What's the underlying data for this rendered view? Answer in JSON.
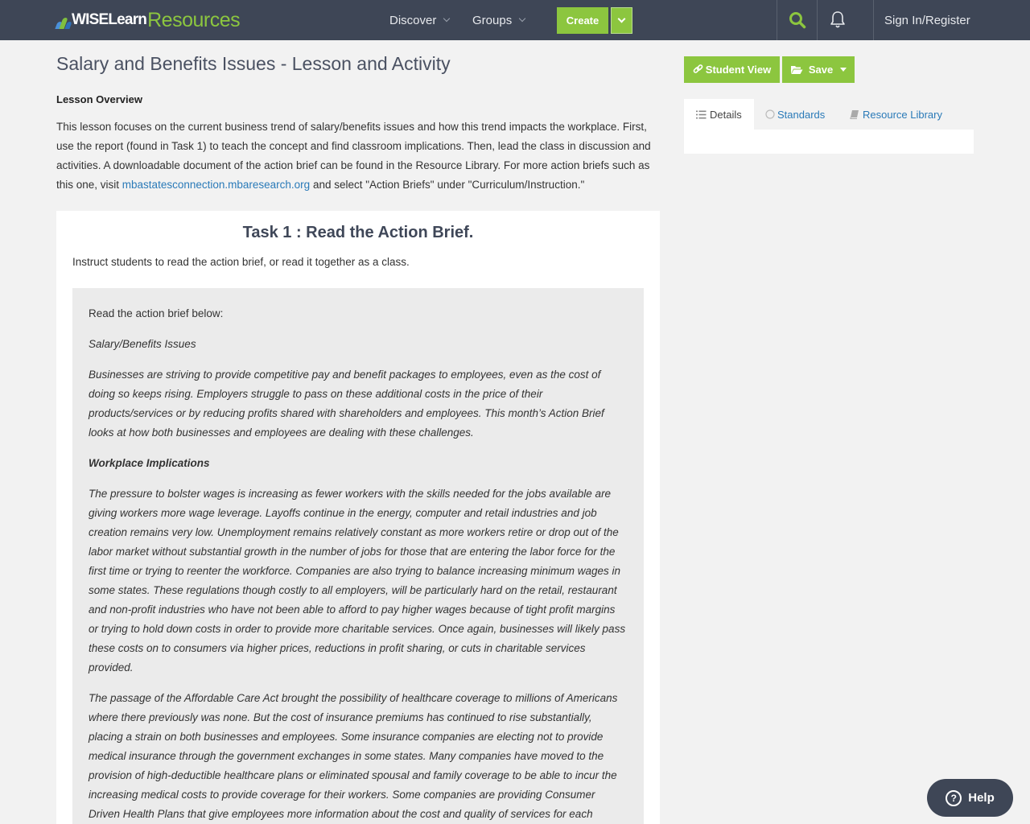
{
  "header": {
    "logo_wise": "WISELearn",
    "logo_resources": "Resources",
    "nav": [
      {
        "label": "Discover"
      },
      {
        "label": "Groups"
      }
    ],
    "create_label": "Create",
    "signin_label": "Sign In/Register",
    "accent_color": "#8cc63f",
    "bar_color": "#3e4656"
  },
  "main": {
    "title": "Salary and Benefits Issues - Lesson and Activity",
    "overview_label": "Lesson Overview",
    "overview_text_1": "This lesson focuses on the current business trend of salary/benefits issues and how this trend impacts the workplace. First, use the report (found in Task 1) to teach the concept and find classroom implications. Then, lead the class in discussion and activities.  A downloadable document of the action brief can be found in the Resource Library. For more action briefs such as this one, visit ",
    "overview_link": "mbastatesconnection.mbaresearch.org",
    "overview_text_2": " and select \"Action Briefs\" under \"Curriculum/Instruction.\"",
    "task": {
      "title": "Task 1 : Read the Action Brief.",
      "instruction": "Instruct students to read the action brief, or read it together as a class.",
      "brief_intro": "Read the action brief below:",
      "brief_heading": "Salary/Benefits Issues",
      "brief_p1": "Businesses are striving to provide competitive pay and benefit packages to employees, even as the cost of doing so keeps rising. Employers struggle to pass on these additional costs in the price of their products/services or by reducing profits shared with shareholders and employees. This month’s Action Brief looks at how both businesses and employees are dealing with these challenges.",
      "brief_subheading": "Workplace Implications",
      "brief_p2": "The pressure to bolster wages is increasing as fewer workers with the skills needed for the jobs available are giving workers more wage leverage. Layoffs continue in the energy, computer and retail industries and job creation remains very low. Unemployment remains relatively constant as more workers retire or drop out of the labor market without substantial growth in the number of jobs for those that are entering the labor force for the first time or trying to reenter the workforce. Companies are also trying to balance increasing minimum wages in some states. These regulations though costly to all employers, will be particularly hard on the retail, restaurant and non-profit industries who have not been able to afford to pay higher wages because of tight profit margins or trying to hold down costs in order to provide more charitable services. Once again, businesses will likely pass these costs on to consumers via higher prices, reductions in profit sharing, or cuts in charitable services provided.",
      "brief_p3": "The passage of the Affordable Care Act brought the possibility of healthcare coverage to millions of Americans where there previously was none. But the cost of insurance premiums has continued to rise substantially, placing a strain on both businesses and employees. Some insurance companies are electing not to provide medical insurance through the government exchanges in some states. Many companies have moved to the provision of high-deductible healthcare plans or eliminated spousal and family coverage to be able to incur the increasing medical costs to provide coverage for their workers. Some companies are providing Consumer Driven Health Plans that give employees more information about the cost and quality of services for each particular provider. This allows greater flexibility in choosing providers and facilities from which to receive services along with more specific"
    }
  },
  "sidebar": {
    "student_view_label": "Student View",
    "save_label": "Save",
    "tabs": [
      {
        "label": "Details"
      },
      {
        "label": "Standards"
      },
      {
        "label": "Resource Library"
      }
    ]
  },
  "help": {
    "label": "Help"
  }
}
